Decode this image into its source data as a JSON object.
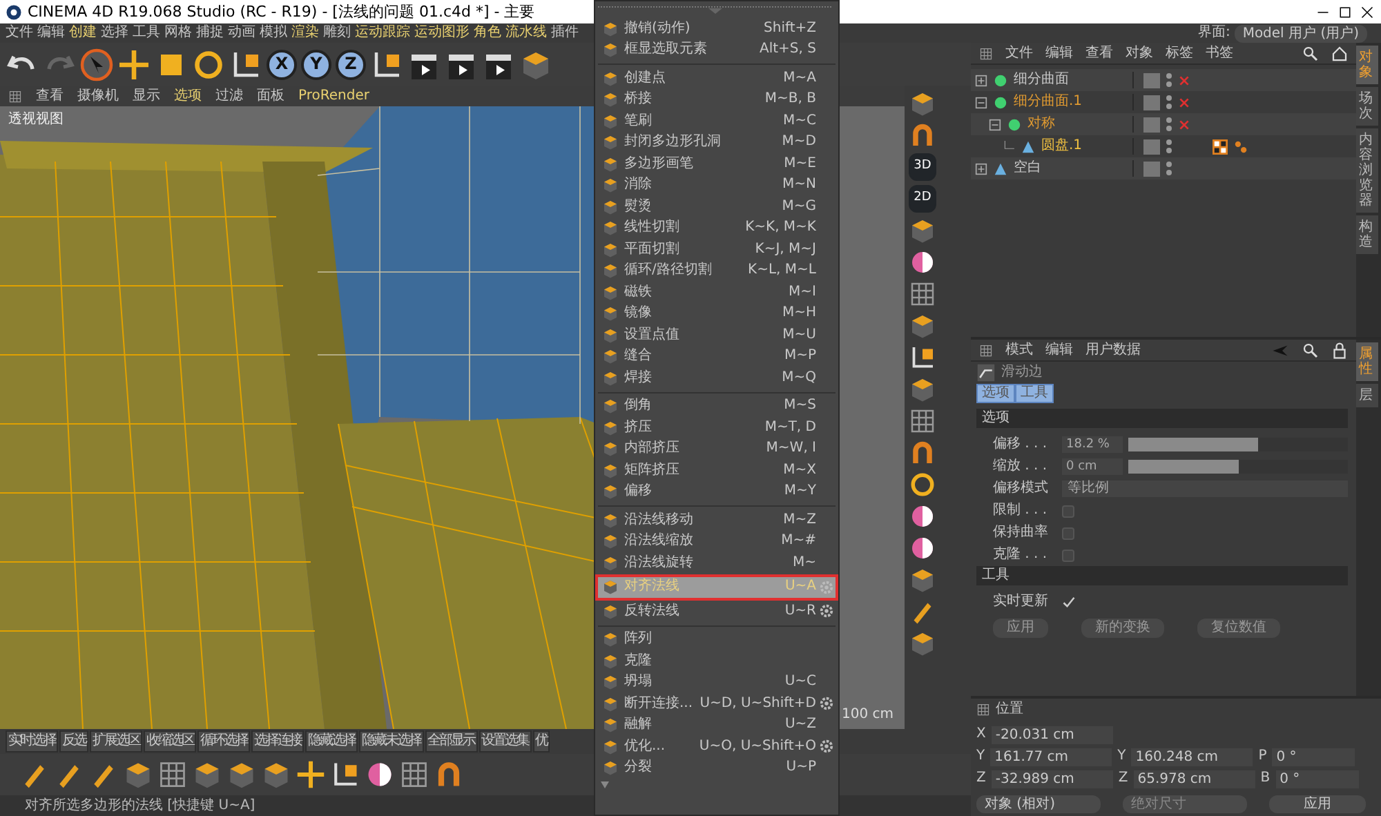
{
  "window": {
    "title": "CINEMA 4D R19.068 Studio (RC - R19) - [法线的问题 01.c4d *] - 主要"
  },
  "menubar": {
    "items": [
      {
        "label": "文件",
        "accent": false
      },
      {
        "label": "编辑",
        "accent": false
      },
      {
        "label": "创建",
        "accent": true
      },
      {
        "label": "选择",
        "accent": false
      },
      {
        "label": "工具",
        "accent": false
      },
      {
        "label": "网格",
        "accent": false
      },
      {
        "label": "捕捉",
        "accent": false
      },
      {
        "label": "动画",
        "accent": false
      },
      {
        "label": "模拟",
        "accent": false
      },
      {
        "label": "渲染",
        "accent": true
      },
      {
        "label": "雕刻",
        "accent": false
      },
      {
        "label": "运动跟踪",
        "accent": true
      },
      {
        "label": "运动图形",
        "accent": true
      },
      {
        "label": "角色",
        "accent": true
      },
      {
        "label": "流水线",
        "accent": true
      },
      {
        "label": "插件",
        "accent": false
      }
    ],
    "layout_label": "界面:",
    "layout_value": "Model 用户 (用户)"
  },
  "toolbar": {
    "axes": [
      {
        "label": "X",
        "on": true
      },
      {
        "label": "Y",
        "on": true
      },
      {
        "label": "Z",
        "on": true
      }
    ]
  },
  "viewport": {
    "menu": [
      {
        "label": "查看",
        "accent": false
      },
      {
        "label": "摄像机",
        "accent": false
      },
      {
        "label": "显示",
        "accent": false
      },
      {
        "label": "选项",
        "accent": true
      },
      {
        "label": "过滤",
        "accent": false
      },
      {
        "label": "面板",
        "accent": false
      },
      {
        "label": "ProRender",
        "accent": true
      }
    ],
    "view_name": "透视视图",
    "grid_spacing": "100 cm"
  },
  "view_mode_labels": [
    "3D",
    "2D"
  ],
  "selection_bar": [
    "实时选择",
    "反选",
    "扩展选区",
    "收缩选区",
    "循环选择",
    "选择连接",
    "隐藏选择",
    "隐藏未选择",
    "全部显示",
    "设置选集",
    "优"
  ],
  "status_bar": "对齐所选多边形的法线 [快捷键 U~A]",
  "context_menu": {
    "sections": [
      [
        {
          "label": "撤销(动作)",
          "shortcut": "Shift+Z",
          "selected": false
        },
        {
          "label": "框显选取元素",
          "shortcut": "Alt+S, S",
          "selected": false
        }
      ],
      [
        {
          "label": "创建点",
          "shortcut": "M~A",
          "selected": false
        },
        {
          "label": "桥接",
          "shortcut": "M~B, B",
          "selected": false
        },
        {
          "label": "笔刷",
          "shortcut": "M~C",
          "selected": false
        },
        {
          "label": "封闭多边形孔洞",
          "shortcut": "M~D",
          "selected": false
        },
        {
          "label": "多边形画笔",
          "shortcut": "M~E",
          "selected": false
        },
        {
          "label": "消除",
          "shortcut": "M~N",
          "selected": false
        },
        {
          "label": "熨烫",
          "shortcut": "M~G",
          "selected": false
        },
        {
          "label": "线性切割",
          "shortcut": "K~K, M~K",
          "selected": false
        },
        {
          "label": "平面切割",
          "shortcut": "K~J, M~J",
          "selected": false
        },
        {
          "label": "循环/路径切割",
          "shortcut": "K~L, M~L",
          "selected": false
        },
        {
          "label": "磁铁",
          "shortcut": "M~I",
          "selected": false
        },
        {
          "label": "镜像",
          "shortcut": "M~H",
          "selected": false
        },
        {
          "label": "设置点值",
          "shortcut": "M~U",
          "selected": false
        },
        {
          "label": "缝合",
          "shortcut": "M~P",
          "selected": false
        },
        {
          "label": "焊接",
          "shortcut": "M~Q",
          "selected": false
        }
      ],
      [
        {
          "label": "倒角",
          "shortcut": "M~S",
          "selected": false
        },
        {
          "label": "挤压",
          "shortcut": "M~T, D",
          "selected": false
        },
        {
          "label": "内部挤压",
          "shortcut": "M~W, I",
          "selected": false
        },
        {
          "label": "矩阵挤压",
          "shortcut": "M~X",
          "selected": false
        },
        {
          "label": "偏移",
          "shortcut": "M~Y",
          "selected": false
        }
      ],
      [
        {
          "label": "沿法线移动",
          "shortcut": "M~Z",
          "selected": false
        },
        {
          "label": "沿法线缩放",
          "shortcut": "M~#",
          "selected": false
        },
        {
          "label": "沿法线旋转",
          "shortcut": "M~",
          "selected": false
        },
        {
          "label": "对齐法线",
          "shortcut": "U~A",
          "selected": true,
          "gear": true,
          "framed": true
        },
        {
          "label": "反转法线",
          "shortcut": "U~R",
          "selected": false,
          "gear": true
        }
      ],
      [
        {
          "label": "阵列",
          "selected": false
        },
        {
          "label": "克隆",
          "selected": false
        },
        {
          "label": "坍塌",
          "shortcut": "U~C",
          "selected": false
        },
        {
          "label": "断开连接...",
          "shortcut": "U~D, U~Shift+D",
          "selected": false,
          "gear": true
        },
        {
          "label": "融解",
          "shortcut": "U~Z",
          "selected": false
        },
        {
          "label": "优化...",
          "shortcut": "U~O, U~Shift+O",
          "selected": false,
          "gear": true
        },
        {
          "label": "分裂",
          "shortcut": "U~P",
          "selected": false
        }
      ]
    ]
  },
  "object_manager": {
    "menu": [
      "文件",
      "编辑",
      "查看",
      "对象",
      "标签",
      "书签"
    ],
    "tree": [
      {
        "name": "细分曲面",
        "color": "#c8c8c8",
        "expanded": false,
        "generator": true,
        "tags": false
      },
      {
        "name": "细分曲面.1",
        "color": "#e09a30",
        "expanded": true,
        "generator": true,
        "tags": false,
        "children": [
          {
            "name": "对称",
            "color": "#e09a30",
            "expanded": true,
            "generator": true,
            "tags": false,
            "children": [
              {
                "name": "圆盘.1",
                "color": "#f0c040",
                "generator": false,
                "tags": true
              }
            ]
          }
        ]
      },
      {
        "name": "空白",
        "color": "#c8c8c8",
        "expanded": false,
        "generator": false,
        "tags": false
      }
    ],
    "side_tabs": [
      {
        "label": "对象",
        "selected": true
      },
      {
        "label": "场次",
        "selected": false
      },
      {
        "label": "内容浏览器",
        "selected": false
      },
      {
        "label": "构造",
        "selected": false
      }
    ]
  },
  "attributes": {
    "menu": [
      "模式",
      "编辑",
      "用户数据"
    ],
    "tool_name": "滑动边",
    "tabs": [
      {
        "label": "选项",
        "selected": true
      },
      {
        "label": "工具",
        "selected": true
      }
    ],
    "sections": [
      {
        "title": "选项",
        "fields": [
          {
            "kind": "slider",
            "label": "偏移 . . .",
            "value": "18.2 %",
            "level": 0.59
          },
          {
            "kind": "slider",
            "label": "缩放 . . .",
            "value": "0 cm",
            "level": 0.5
          },
          {
            "kind": "dropdown",
            "label": "偏移模式",
            "value": "等比例"
          },
          {
            "kind": "checkbox",
            "label": "限制 . . .",
            "checked": false
          },
          {
            "kind": "checkbox",
            "label": "保持曲率",
            "checked": false
          },
          {
            "kind": "checkbox",
            "label": "克隆 . . .",
            "checked": false
          }
        ]
      },
      {
        "title": "工具",
        "fields": [
          {
            "kind": "checkbox",
            "label": "实时更新",
            "checked": true
          }
        ],
        "buttons": [
          "应用",
          "新的变换",
          "复位数值"
        ]
      }
    ],
    "side_tabs": [
      {
        "label": "属性",
        "selected": true
      },
      {
        "label": "层",
        "selected": false
      }
    ]
  },
  "coordinates": {
    "header": "位置",
    "rows": [
      {
        "axis": "X",
        "value": "-20.031 cm"
      },
      {
        "axis": "Y",
        "value": "161.77 cm",
        "size_axis": "Y",
        "size": "160.248 cm",
        "rot_axis": "P",
        "rot": "0 °"
      },
      {
        "axis": "Z",
        "value": "-32.989 cm",
        "size_axis": "Z",
        "size": "65.978 cm",
        "rot_axis": "B",
        "rot": "0 °"
      }
    ],
    "mode": "对象 (相对)",
    "size_mode": "绝对尺寸",
    "apply": "应用"
  }
}
